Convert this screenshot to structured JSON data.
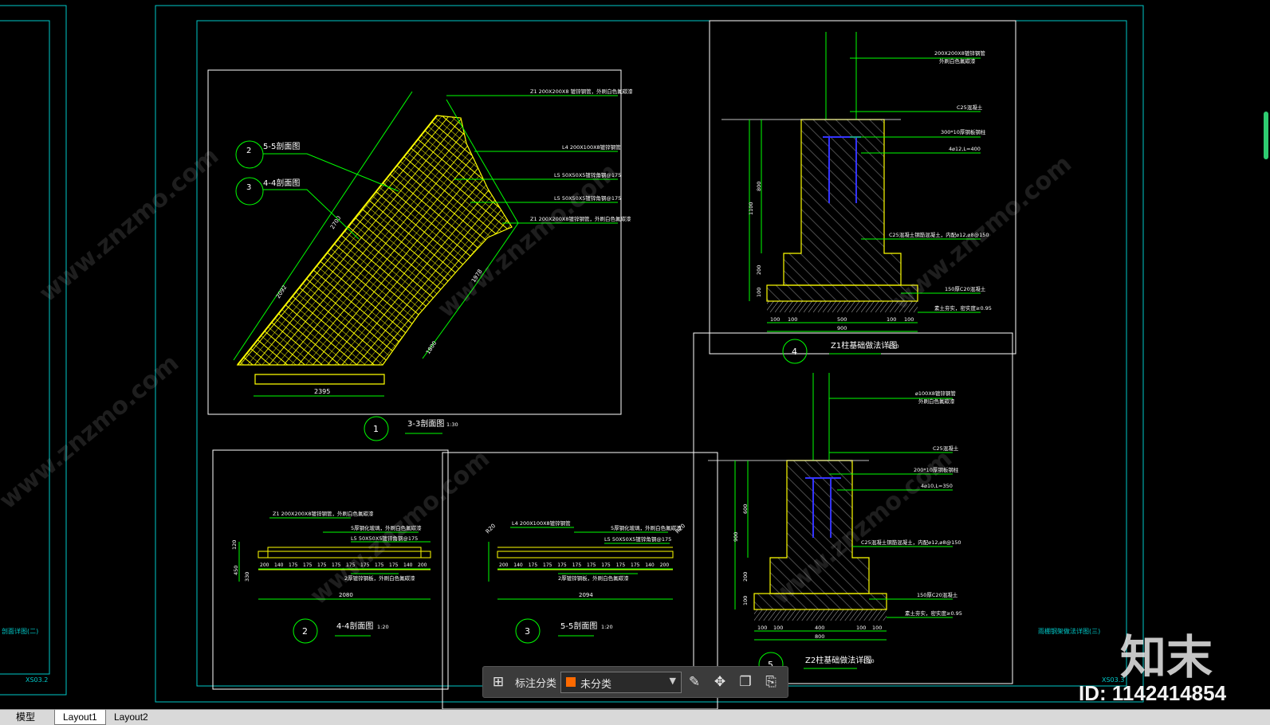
{
  "drawing": {
    "left_sheet_title": "剖面详图(二)",
    "left_sheet_no": "XS03.2",
    "right_sheet_title": "雨棚钢架做法详图(三)",
    "right_sheet_no": "XS03.3",
    "view1": {
      "number": "1",
      "title": "3-3剖面图",
      "scale": "1:30",
      "callout_2": "2",
      "callout_2_label": "5-5剖面图",
      "callout_3": "3",
      "callout_3_label": "4-4剖面图",
      "notes": [
        "Z1 200X200X8 镀锌钢管，外刷白色氟碳漆",
        "L4 200X100X8镀锌钢管",
        "L5 50X50X5镀锌角钢@175",
        "L5 50X50X5镀锌角钢@175",
        "Z1 200X200X8镀锌钢管，外刷白色氟碳漆"
      ],
      "dims": [
        "2395",
        "2092",
        "2700",
        "1978",
        "1800"
      ]
    },
    "view2": {
      "number": "2",
      "title": "4-4剖面图",
      "scale": "1:20",
      "notes": [
        "Z1 200X200X8镀锌钢管，外刷白色氟碳漆",
        "5厚钢化玻璃，外刷白色氟碳漆",
        "L5 50X50X5镀锌角钢@175",
        "2厚镀锌钢板，外刷白色氟碳漆"
      ],
      "bay_dims": [
        "200",
        "140",
        "175",
        "175",
        "175",
        "175",
        "175",
        "175",
        "175",
        "175",
        "140",
        "200"
      ],
      "total": "2080",
      "h1": "120",
      "h2": "330",
      "h3": "450"
    },
    "view3": {
      "number": "3",
      "title": "5-5剖面图",
      "scale": "1:20",
      "notes": [
        "L4 200X100X8镀锌钢管",
        "5厚钢化玻璃，外刷白色氟碳漆",
        "L5 50X50X5镀锌角钢@175",
        "2厚镀锌钢板，外刷白色氟碳漆"
      ],
      "bay_dims": [
        "200",
        "140",
        "175",
        "175",
        "175",
        "175",
        "175",
        "175",
        "175",
        "175",
        "140",
        "200"
      ],
      "total": "2094",
      "r_left": "R20",
      "r_right": "R20"
    },
    "view4": {
      "number": "4",
      "title": "Z1柱基础做法详图",
      "scale": "1:10",
      "notes": [
        "200X200X8镀锌钢管",
        "外刷白色氟碳漆",
        "C25混凝土",
        "300*10厚钢板钢柱",
        "4⌀12,L=400",
        "C25混凝土钢筋混凝土，内配⌀12,⌀8@150",
        "150厚C20混凝土",
        "素土夯实，密实度≥0.95"
      ],
      "dims_v": [
        "800",
        "1100",
        "200",
        "100"
      ],
      "dims_h": [
        "100",
        "100",
        "500",
        "100",
        "100"
      ],
      "total": "900"
    },
    "view5": {
      "number": "5",
      "title": "Z2柱基础做法详图",
      "scale": "1:10",
      "notes": [
        "⌀100X8镀锌钢管",
        "外刷白色氟碳漆",
        "C25混凝土",
        "200*10厚钢板钢柱",
        "4⌀10,L=350",
        "C25混凝土钢筋混凝土，内配⌀12,⌀8@150",
        "150厚C20混凝土",
        "素土夯实，密实度≥0.95"
      ],
      "dims_v": [
        "600",
        "900",
        "200",
        "100"
      ],
      "dims_h": [
        "100",
        "100",
        "400",
        "100",
        "100"
      ],
      "total": "800"
    }
  },
  "toolbar": {
    "label": "标注分类",
    "select_value": "未分类",
    "select_color": "#ff6a00"
  },
  "tabs": [
    "模型",
    "Layout1",
    "Layout2"
  ],
  "watermark": {
    "logo": "知末",
    "id": "ID: 1142414854",
    "site": "www.znzmo.com"
  },
  "colors": {
    "frame": "#00c8c8",
    "dim": "#00ff00",
    "hatch": "#ffff00",
    "rebar": "#3333ff",
    "text": "#ffffff"
  }
}
